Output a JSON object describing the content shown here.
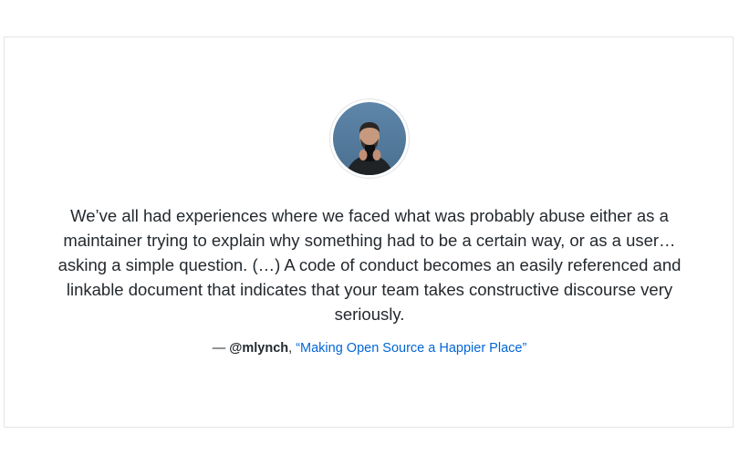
{
  "testimonial": {
    "quote": "We’ve all had experiences where we faced what was probably abuse either as a maintainer trying to explain why something had to be a certain way, or as a user…asking a simple question. (…) A code of conduct becomes an easily referenced and linkable document that indicates that your team takes constructive discourse very seriously.",
    "dash": "— ",
    "author": "@mlynch",
    "separator": ", ",
    "source_link": "“Making Open Source a Happier Place”",
    "avatar_icon": "user-photo-avatar"
  },
  "colors": {
    "text": "#24292e",
    "link": "#0366d6",
    "border": "#e1e4e8"
  }
}
